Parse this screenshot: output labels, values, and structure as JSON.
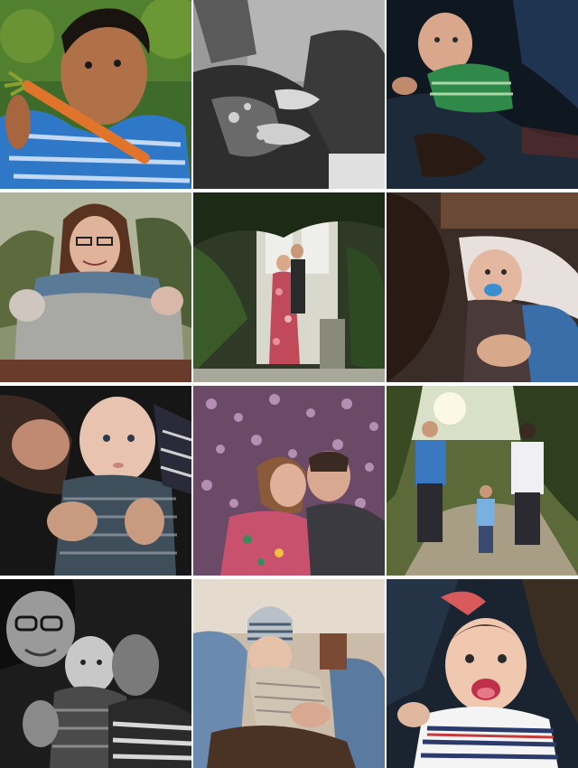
{
  "gallery": {
    "photos": [
      {
        "subject": "boy-eating-carrot",
        "bg": "#3f6b2a",
        "accent": "#2f78c8"
      },
      {
        "subject": "pregnant-couple-bw",
        "bg": "#8a8a8a",
        "accent": "#3a3a3a"
      },
      {
        "subject": "baby-green-shirt",
        "bg": "#0f1820",
        "accent": "#2f8a4a"
      },
      {
        "subject": "mother-with-twins",
        "bg": "#6e7a5a",
        "accent": "#c99c84"
      },
      {
        "subject": "couple-in-doorway",
        "bg": "#2f3a26",
        "accent": "#c04a5a"
      },
      {
        "subject": "baby-with-pacifier",
        "bg": "#3a2c26",
        "accent": "#3a8fd0"
      },
      {
        "subject": "parent-kissing-baby",
        "bg": "#161616",
        "accent": "#3e4e5a"
      },
      {
        "subject": "couple-kissing-flowers",
        "bg": "#6a4a66",
        "accent": "#c8526e"
      },
      {
        "subject": "family-walking-path",
        "bg": "#5c6a3a",
        "accent": "#3a78c0"
      },
      {
        "subject": "family-with-baby-bw",
        "bg": "#2a2a2a",
        "accent": "#9a9a9a"
      },
      {
        "subject": "baby-in-striped-hat",
        "bg": "#c8b8a6",
        "accent": "#6a8ab0"
      },
      {
        "subject": "laughing-baby",
        "bg": "#1a2430",
        "accent": "#c23a3a"
      }
    ]
  }
}
